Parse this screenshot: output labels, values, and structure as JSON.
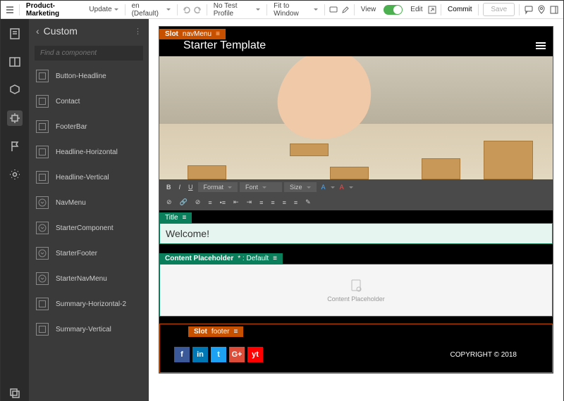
{
  "topbar": {
    "project": "Product-Marketing",
    "mode": "Update",
    "locale": "en (Default)",
    "profile": "No Test Profile",
    "fit": "Fit to Window",
    "view": "View",
    "edit": "Edit",
    "commit": "Commit",
    "save": "Save"
  },
  "sidebar": {
    "title": "Custom",
    "search_placeholder": "Find a component",
    "items": [
      {
        "label": "Button-Headline",
        "icon": "sq"
      },
      {
        "label": "Contact",
        "icon": "sq"
      },
      {
        "label": "FooterBar",
        "icon": "sq"
      },
      {
        "label": "Headline-Horizontal",
        "icon": "sq"
      },
      {
        "label": "Headline-Vertical",
        "icon": "sq"
      },
      {
        "label": "NavMenu",
        "icon": "dn"
      },
      {
        "label": "StarterComponent",
        "icon": "dn"
      },
      {
        "label": "StarterFooter",
        "icon": "dn"
      },
      {
        "label": "StarterNavMenu",
        "icon": "dn"
      },
      {
        "label": "Summary-Horizontal-2",
        "icon": "sq"
      },
      {
        "label": "Summary-Vertical",
        "icon": "sq"
      }
    ]
  },
  "page": {
    "slot_nav": "Slot",
    "slot_nav_name": "navMenu",
    "title": "Starter Template",
    "title_chip": "Title",
    "title_value": "Welcome!",
    "placeholder_chip": "Content Placeholder",
    "placeholder_suffix": "* : Default",
    "placeholder_text": "Content Placeholder",
    "slot_footer": "Slot",
    "slot_footer_name": "footer",
    "copyright": "COPYRIGHT © 2018",
    "rte": {
      "format": "Format",
      "font": "Font",
      "size": "Size"
    },
    "social": [
      "f",
      "in",
      "t",
      "G+",
      "yt"
    ],
    "social_colors": [
      "#3b5998",
      "#0077b5",
      "#1da1f2",
      "#dd4b39",
      "#ff0000"
    ]
  }
}
